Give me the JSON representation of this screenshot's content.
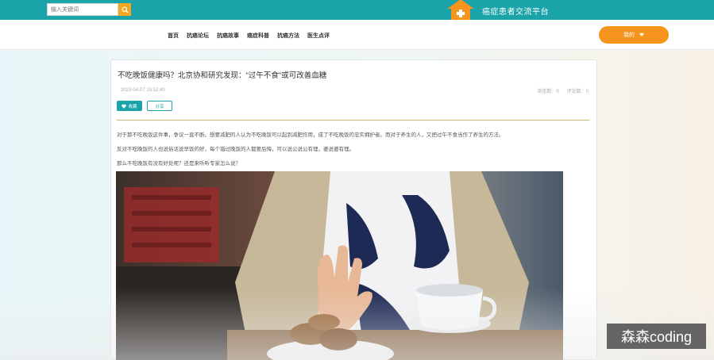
{
  "header": {
    "search_placeholder": "输入关键词",
    "site_title": "癌症患者交流平台"
  },
  "nav": {
    "items": [
      "首页",
      "抗癌论坛",
      "抗癌故事",
      "癌症科普",
      "抗癌方法",
      "医生点评"
    ],
    "user_menu_label": "我的"
  },
  "article": {
    "title": "不吃晚饭健康吗？北京协和研究发现：\"过午不食\"或可改善血糖",
    "date": "2023-04-07 15:52:40",
    "views_label": "浏览数：0",
    "comments_label": "评论数：0",
    "favorite_label": "收藏",
    "share_label": "分享",
    "paragraphs": [
      "对于那不吃晚饭这件事，争议一直不断。想要减肥的人认为不吃晚饭可以起到减肥作用，成了不吃晚饭的忠实拥护者。而对于养生的人，又把过午不食当作了养生的方法。",
      "反对不吃晚饭的人也说俗话说早饭的好，每个错过晚饭的人都要后悔，可以说公说公有理，婆说婆有理。",
      "那么不吃晚饭有没有好处呢？还是来听听专家怎么说？"
    ]
  },
  "overlay": {
    "watermark": "森森coding"
  },
  "colors": {
    "teal": "#1aa3a8",
    "orange": "#f7941d",
    "search_button": "#f5a623"
  }
}
